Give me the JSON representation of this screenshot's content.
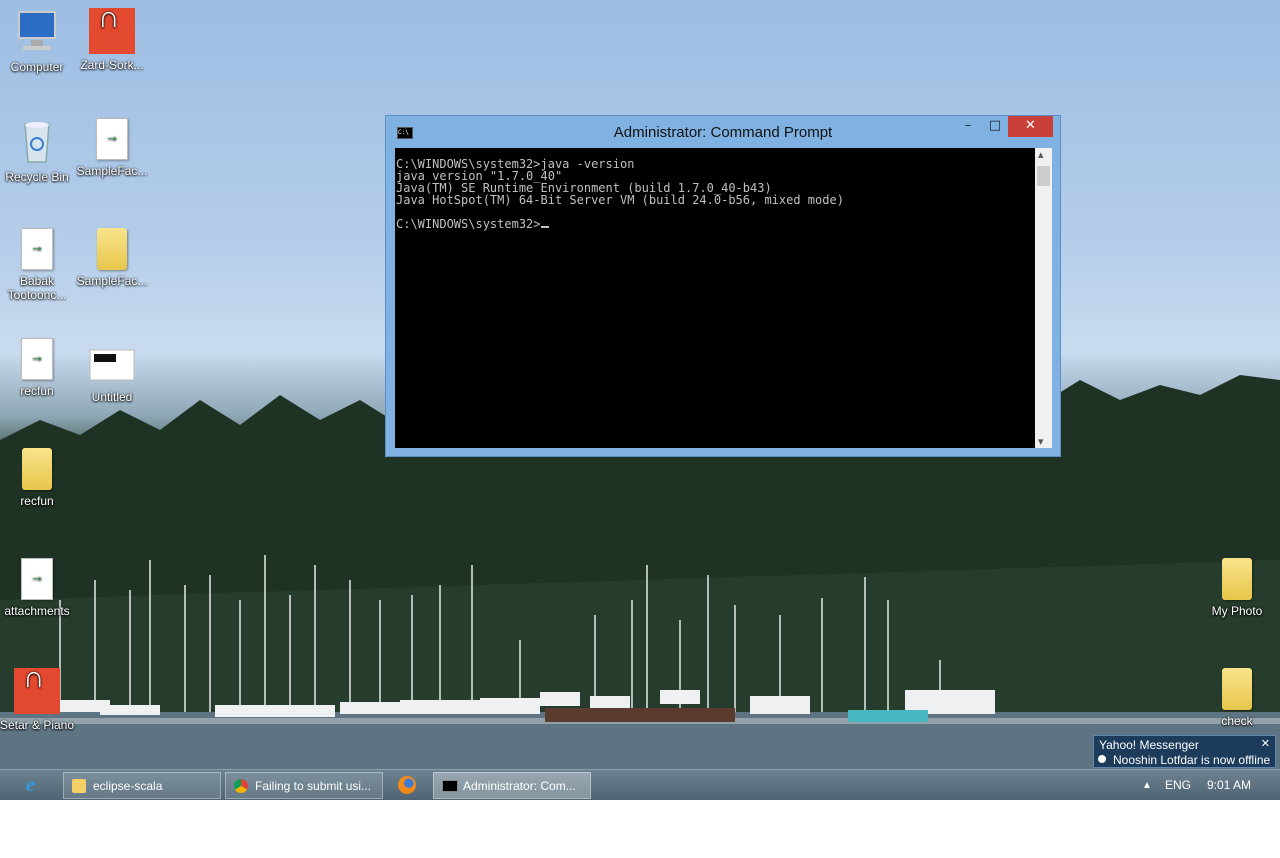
{
  "desktop": {
    "icons": [
      {
        "label": "Computer",
        "icon": "computer-icon"
      },
      {
        "label": "Zard-Sork...",
        "icon": "headphones-icon"
      },
      {
        "label": "Recycle Bin",
        "icon": "recycle-bin-icon"
      },
      {
        "label": "SampleFac...",
        "icon": "document-icon"
      },
      {
        "label": "Babak Tootoonc...",
        "icon": "document-icon"
      },
      {
        "label": "SampleFac...",
        "icon": "folder-icon"
      },
      {
        "label": "recfun",
        "icon": "document-icon"
      },
      {
        "label": "Untitled",
        "icon": "image-file-icon"
      },
      {
        "label": "recfun",
        "icon": "folder-icon"
      },
      {
        "label": "attachments",
        "icon": "document-icon"
      },
      {
        "label": "Setar & Piano",
        "icon": "headphones-icon"
      },
      {
        "label": "My Photo",
        "icon": "folder-icon"
      },
      {
        "label": "check",
        "icon": "folder-icon"
      }
    ]
  },
  "cmd_window": {
    "title": "Administrator: Command Prompt",
    "minimize": "–",
    "maximize": "□",
    "close": "✕",
    "lines": [
      "C:\\WINDOWS\\system32>java -version",
      "java version \"1.7.0_40\"",
      "Java(TM) SE Runtime Environment (build 1.7.0_40-b43)",
      "Java HotSpot(TM) 64-Bit Server VM (build 24.0-b56, mixed mode)",
      "",
      "C:\\WINDOWS\\system32>"
    ],
    "scroll_up": "▴",
    "scroll_down": "▾"
  },
  "notification": {
    "app": "Yahoo! Messenger",
    "message": "Nooshin Lotfdar is now offline",
    "close": "✕"
  },
  "taskbar": {
    "buttons": [
      {
        "label": "eclipse-scala",
        "icon": "folder-icon"
      },
      {
        "label": "Failing to submit usi...",
        "icon": "chrome-icon"
      },
      {
        "label": "Administrator: Com...",
        "icon": "cmd-icon"
      }
    ],
    "language": "ENG",
    "time": "9:01 AM"
  },
  "colors": {
    "close_button": "#c9403a",
    "console_bg": "#000000",
    "console_text": "#c0c0c0",
    "window_frame": "#7fb2e3"
  }
}
